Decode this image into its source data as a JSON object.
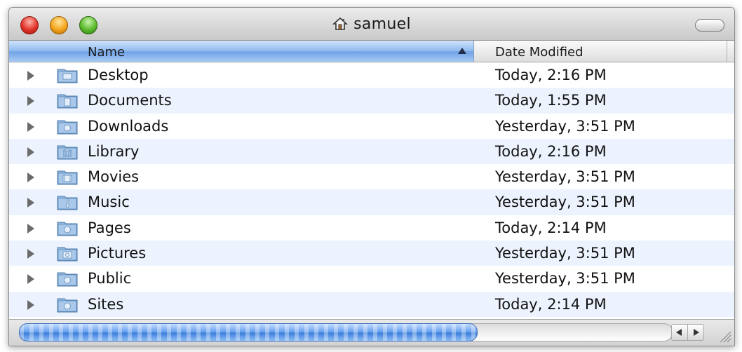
{
  "window": {
    "title": "samuel"
  },
  "columns": {
    "name": "Name",
    "date_modified": "Date Modified"
  },
  "accent": "#6fa2e6",
  "rows": [
    {
      "name": "Desktop",
      "date": "Today, 2:16 PM",
      "icon": "desktop-folder-icon"
    },
    {
      "name": "Documents",
      "date": "Today, 1:55 PM",
      "icon": "documents-folder-icon"
    },
    {
      "name": "Downloads",
      "date": "Yesterday, 3:51 PM",
      "icon": "downloads-folder-icon"
    },
    {
      "name": "Library",
      "date": "Today, 2:16 PM",
      "icon": "library-folder-icon"
    },
    {
      "name": "Movies",
      "date": "Yesterday, 3:51 PM",
      "icon": "movies-folder-icon"
    },
    {
      "name": "Music",
      "date": "Yesterday, 3:51 PM",
      "icon": "music-folder-icon"
    },
    {
      "name": "Pages",
      "date": "Today, 2:14 PM",
      "icon": "pages-folder-icon"
    },
    {
      "name": "Pictures",
      "date": "Yesterday, 3:51 PM",
      "icon": "pictures-folder-icon"
    },
    {
      "name": "Public",
      "date": "Yesterday, 3:51 PM",
      "icon": "public-folder-icon"
    },
    {
      "name": "Sites",
      "date": "Today, 2:14 PM",
      "icon": "sites-folder-icon"
    }
  ]
}
